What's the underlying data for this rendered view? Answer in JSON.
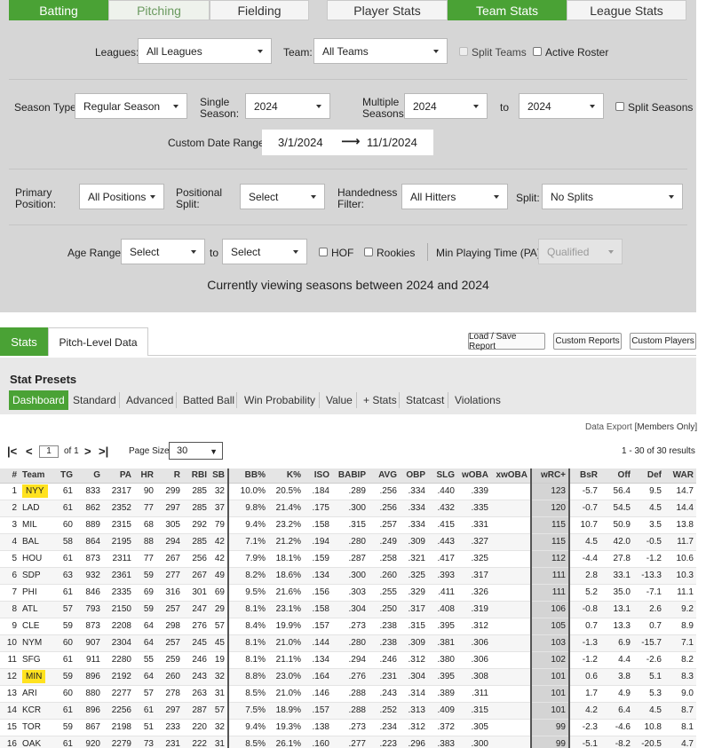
{
  "tabs": {
    "batting": "Batting",
    "pitching": "Pitching",
    "fielding": "Fielding",
    "player_stats": "Player Stats",
    "team_stats": "Team Stats",
    "league_stats": "League Stats"
  },
  "filters": {
    "leagues_label": "Leagues:",
    "leagues_value": "All Leagues",
    "team_label": "Team:",
    "team_value": "All Teams",
    "split_teams": "Split Teams",
    "active_roster": "Active Roster",
    "season_type_label": "Season Type:",
    "season_type_value": "Regular Season",
    "single_season_label_1": "Single",
    "single_season_label_2": "Season:",
    "single_season_value": "2024",
    "multiple_seasons_label_1": "Multiple",
    "multiple_seasons_label_2": "Seasons:",
    "multiple_from": "2024",
    "to_label": "to",
    "multiple_to": "2024",
    "split_seasons": "Split Seasons",
    "custom_date_label": "Custom Date Range:",
    "date_from": "3/1/2024",
    "date_to": "11/1/2024",
    "primary_position_label_1": "Primary",
    "primary_position_label_2": "Position:",
    "primary_position_value": "All Positions",
    "positional_split_label_1": "Positional",
    "positional_split_label_2": "Split:",
    "positional_split_value": "Select",
    "handedness_label_1": "Handedness",
    "handedness_label_2": "Filter:",
    "handedness_value": "All Hitters",
    "split_label": "Split:",
    "split_value": "No Splits",
    "age_range_label": "Age Range:",
    "age_from": "Select",
    "age_to_label": "to",
    "age_to": "Select",
    "hof": "HOF",
    "rookies": "Rookies",
    "min_pt_label": "Min Playing Time (PA):",
    "min_pt_value": "Qualified",
    "viewing_text": "Currently viewing seasons between 2024 and 2024"
  },
  "stats_tabs": {
    "stats": "Stats",
    "pitch_level": "Pitch-Level Data"
  },
  "buttons": {
    "load_save": "Load / Save Report",
    "custom_reports": "Custom Reports",
    "custom_players": "Custom Players"
  },
  "presets": {
    "title": "Stat Presets",
    "items": [
      "Dashboard",
      "Standard",
      "Advanced",
      "Batted Ball",
      "Win Probability",
      "Value",
      "+ Stats",
      "Statcast",
      "Violations"
    ]
  },
  "export": {
    "prefix": "Data Export",
    "members": "[Members Only]"
  },
  "pager": {
    "page": "1",
    "of_text": "of 1",
    "page_size_label": "Page Size:",
    "page_size": "30",
    "results": "1 - 30 of 30 results"
  },
  "table": {
    "headers": [
      "#",
      "Team",
      "TG",
      "G",
      "PA",
      "HR",
      "R",
      "RBI",
      "SB",
      "BB%",
      "K%",
      "ISO",
      "BABIP",
      "AVG",
      "OBP",
      "SLG",
      "wOBA",
      "xwOBA",
      "wRC+",
      "BsR",
      "Off",
      "Def",
      "WAR"
    ],
    "rows": [
      [
        "1",
        "NYY",
        "61",
        "833",
        "2317",
        "90",
        "299",
        "285",
        "32",
        "10.0%",
        "20.5%",
        ".184",
        ".289",
        ".256",
        ".334",
        ".440",
        ".339",
        "",
        "123",
        "-5.7",
        "56.4",
        "9.5",
        "14.7"
      ],
      [
        "2",
        "LAD",
        "61",
        "862",
        "2352",
        "77",
        "297",
        "285",
        "37",
        "9.8%",
        "21.4%",
        ".175",
        ".300",
        ".256",
        ".334",
        ".432",
        ".335",
        "",
        "120",
        "-0.7",
        "54.5",
        "4.5",
        "14.4"
      ],
      [
        "3",
        "MIL",
        "60",
        "889",
        "2315",
        "68",
        "305",
        "292",
        "79",
        "9.4%",
        "23.2%",
        ".158",
        ".315",
        ".257",
        ".334",
        ".415",
        ".331",
        "",
        "115",
        "10.7",
        "50.9",
        "3.5",
        "13.8"
      ],
      [
        "4",
        "BAL",
        "58",
        "864",
        "2195",
        "88",
        "294",
        "285",
        "42",
        "7.1%",
        "21.2%",
        ".194",
        ".280",
        ".249",
        ".309",
        ".443",
        ".327",
        "",
        "115",
        "4.5",
        "42.0",
        "-0.5",
        "11.7"
      ],
      [
        "5",
        "HOU",
        "61",
        "873",
        "2311",
        "77",
        "267",
        "256",
        "42",
        "7.9%",
        "18.1%",
        ".159",
        ".287",
        ".258",
        ".321",
        ".417",
        ".325",
        "",
        "112",
        "-4.4",
        "27.8",
        "-1.2",
        "10.6"
      ],
      [
        "6",
        "SDP",
        "63",
        "932",
        "2361",
        "59",
        "277",
        "267",
        "49",
        "8.2%",
        "18.6%",
        ".134",
        ".300",
        ".260",
        ".325",
        ".393",
        ".317",
        "",
        "111",
        "2.8",
        "33.1",
        "-13.3",
        "10.3"
      ],
      [
        "7",
        "PHI",
        "61",
        "846",
        "2335",
        "69",
        "316",
        "301",
        "69",
        "9.5%",
        "21.6%",
        ".156",
        ".303",
        ".255",
        ".329",
        ".411",
        ".326",
        "",
        "111",
        "5.2",
        "35.0",
        "-7.1",
        "11.1"
      ],
      [
        "8",
        "ATL",
        "57",
        "793",
        "2150",
        "59",
        "257",
        "247",
        "29",
        "8.1%",
        "23.1%",
        ".158",
        ".304",
        ".250",
        ".317",
        ".408",
        ".319",
        "",
        "106",
        "-0.8",
        "13.1",
        "2.6",
        "9.2"
      ],
      [
        "9",
        "CLE",
        "59",
        "873",
        "2208",
        "64",
        "298",
        "276",
        "57",
        "8.4%",
        "19.9%",
        ".157",
        ".273",
        ".238",
        ".315",
        ".395",
        ".312",
        "",
        "105",
        "0.7",
        "13.3",
        "0.7",
        "8.9"
      ],
      [
        "10",
        "NYM",
        "60",
        "907",
        "2304",
        "64",
        "257",
        "245",
        "45",
        "8.1%",
        "21.0%",
        ".144",
        ".280",
        ".238",
        ".309",
        ".381",
        ".306",
        "",
        "103",
        "-1.3",
        "6.9",
        "-15.7",
        "7.1"
      ],
      [
        "11",
        "SFG",
        "61",
        "911",
        "2280",
        "55",
        "259",
        "246",
        "19",
        "8.1%",
        "21.1%",
        ".134",
        ".294",
        ".246",
        ".312",
        ".380",
        ".306",
        "",
        "102",
        "-1.2",
        "4.4",
        "-2.6",
        "8.2"
      ],
      [
        "12",
        "MIN",
        "59",
        "896",
        "2192",
        "64",
        "260",
        "243",
        "32",
        "8.8%",
        "23.0%",
        ".164",
        ".276",
        ".231",
        ".304",
        ".395",
        ".308",
        "",
        "101",
        "0.6",
        "3.8",
        "5.1",
        "8.3"
      ],
      [
        "13",
        "ARI",
        "60",
        "880",
        "2277",
        "57",
        "278",
        "263",
        "31",
        "8.5%",
        "21.0%",
        ".146",
        ".288",
        ".243",
        ".314",
        ".389",
        ".311",
        "",
        "101",
        "1.7",
        "4.9",
        "5.3",
        "9.0"
      ],
      [
        "14",
        "KCR",
        "61",
        "896",
        "2256",
        "61",
        "297",
        "287",
        "57",
        "7.5%",
        "18.9%",
        ".157",
        ".288",
        ".252",
        ".313",
        ".409",
        ".315",
        "",
        "101",
        "4.2",
        "6.4",
        "4.5",
        "8.7"
      ],
      [
        "15",
        "TOR",
        "59",
        "867",
        "2198",
        "51",
        "233",
        "220",
        "32",
        "9.4%",
        "19.3%",
        ".138",
        ".273",
        ".234",
        ".312",
        ".372",
        ".305",
        "",
        "99",
        "-2.3",
        "-4.6",
        "10.8",
        "8.1"
      ],
      [
        "16",
        "OAK",
        "61",
        "920",
        "2279",
        "73",
        "231",
        "222",
        "31",
        "8.5%",
        "26.1%",
        ".160",
        ".277",
        ".223",
        ".296",
        ".383",
        ".300",
        "",
        "99",
        "-5.1",
        "-8.2",
        "-20.5",
        "4.7"
      ]
    ],
    "highlighted_teams": [
      "NYY",
      "MIN"
    ],
    "colors": {
      "accent": "#4aa235",
      "highlight": "#ffe21f"
    }
  }
}
